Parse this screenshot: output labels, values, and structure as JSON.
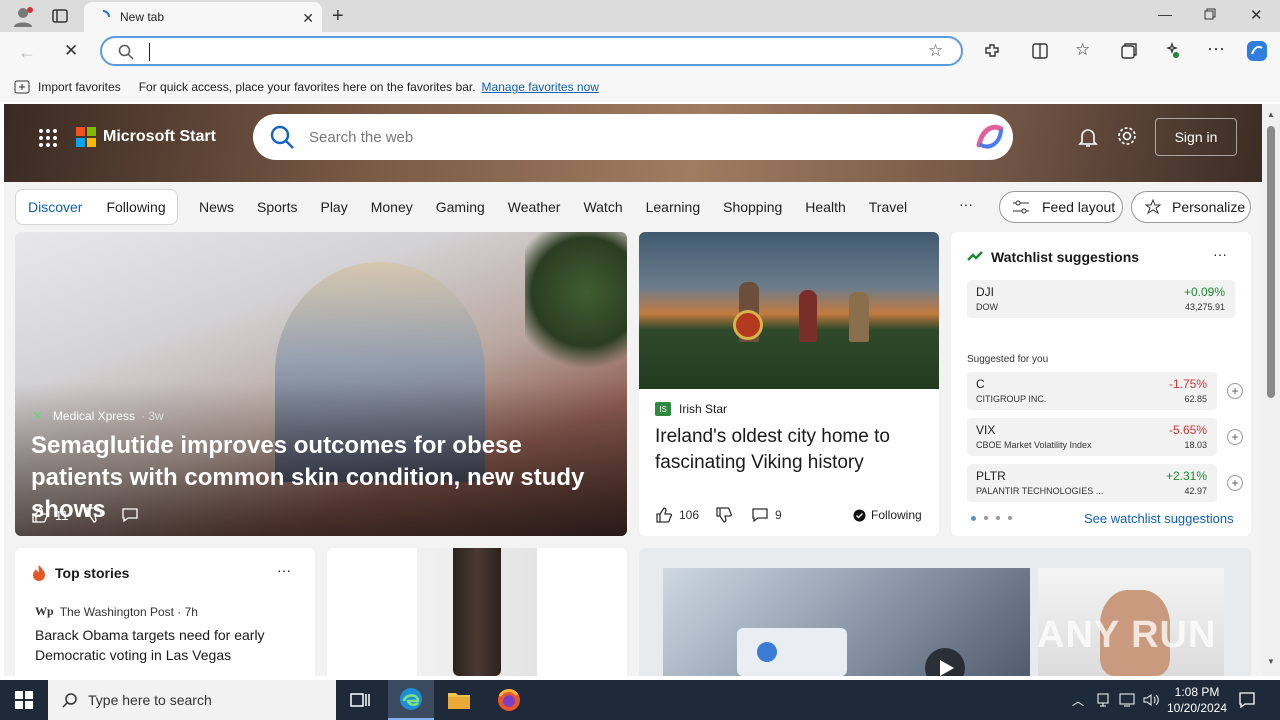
{
  "browser": {
    "tab_title": "New tab",
    "favbar_import": "Import favorites",
    "favbar_hint": "For quick access, place your favorites here on the favorites bar.",
    "favbar_link": "Manage favorites now"
  },
  "header": {
    "brand": "Microsoft Start",
    "search_placeholder": "Search the web",
    "signin": "Sign in"
  },
  "nav": {
    "discover": "Discover",
    "following": "Following",
    "links": [
      "News",
      "Sports",
      "Play",
      "Money",
      "Gaming",
      "Weather",
      "Watch",
      "Learning",
      "Shopping",
      "Health",
      "Travel"
    ],
    "more": "···",
    "feed_layout": "Feed layout",
    "personalize": "Personalize"
  },
  "main_story": {
    "source": "Medical Xpress",
    "age": "· 3w",
    "headline": "Semaglutide improves outcomes for obese patients with common skin condition, new study shows",
    "likes": "11"
  },
  "story2": {
    "source": "Irish Star",
    "headline": "Ireland's oldest city home to fascinating Viking history",
    "likes": "106",
    "comments": "9",
    "following": "Following"
  },
  "watchlist": {
    "title": "Watchlist suggestions",
    "more": "···",
    "main": {
      "symbol": "DJI",
      "name": "DOW",
      "change": "+0.09%",
      "price": "43,275.91"
    },
    "suggested_label": "Suggested for you",
    "items": [
      {
        "symbol": "C",
        "name": "CITIGROUP INC.",
        "change": "-1.75%",
        "price": "62.85"
      },
      {
        "symbol": "VIX",
        "name": "CBOE Market Volatility Index",
        "change": "-5.65%",
        "price": "18.03"
      },
      {
        "symbol": "PLTR",
        "name": "PALANTIR TECHNOLOGIES ...",
        "change": "+2.31%",
        "price": "42.97"
      }
    ],
    "see_more": "See watchlist suggestions",
    "colors": {
      "up": "#1a8a2e",
      "down": "#d13438"
    }
  },
  "top_stories": {
    "title": "Top stories",
    "more": "···",
    "source": "The Washington Post · 7h",
    "headline": "Barack Obama targets need for early Democratic voting in Las Vegas"
  },
  "watermark": "ANY RUN",
  "taskbar": {
    "search_placeholder": "Type here to search",
    "time": "1:08 PM",
    "date": "10/20/2024"
  }
}
